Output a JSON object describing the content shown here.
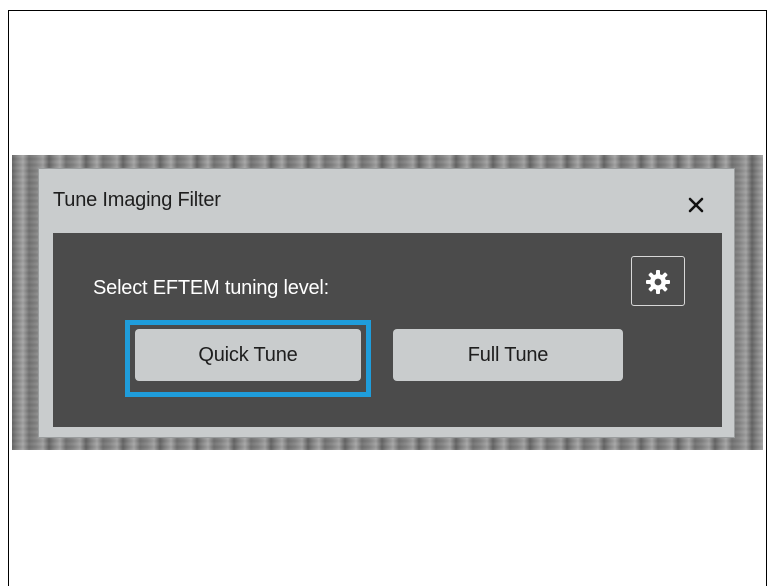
{
  "dialog": {
    "title": "Tune Imaging Filter",
    "close_icon": "close-icon",
    "prompt": "Select EFTEM tuning level:",
    "settings_icon": "gear-icon",
    "buttons": {
      "quick_tune": "Quick Tune",
      "full_tune": "Full Tune"
    },
    "focused_button": "quick_tune"
  },
  "colors": {
    "dialog_background": "#c9cccd",
    "body_background": "#4b4b4b",
    "focus_ring": "#1f9ddb",
    "prompt_text": "#ffffff"
  }
}
